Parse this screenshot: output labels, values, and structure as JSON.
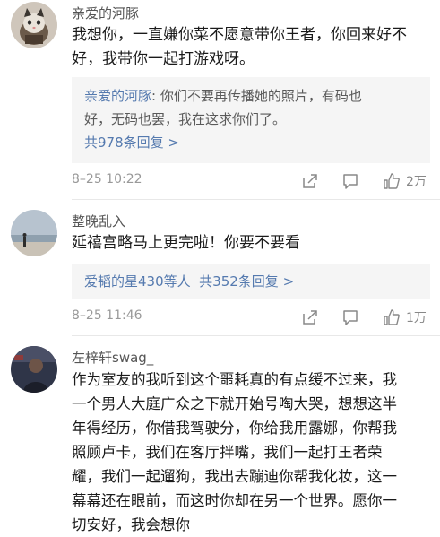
{
  "comments": [
    {
      "username": "亲爱的河豚",
      "lines": [
        "我想你，一直嫌你菜不愿意带你王者，你回来好不",
        "好，我带你一起打游戏呀。"
      ],
      "reply": {
        "author": "亲爱的河豚",
        "colon": ":",
        "text_line1": " 你们不要再传播她的照片，有码也",
        "text_line2": "好，无码也罢，我在这求你们了。",
        "link": "共978条回复 >"
      },
      "time": "8–25 10:22",
      "likes": "2万"
    },
    {
      "username": "整晚乱入",
      "lines": [
        "延禧宫略马上更完啦！你要不要看"
      ],
      "reply": {
        "link": "爱韬的星430等人  共352条回复 >"
      },
      "time": "8–25 11:46",
      "likes": "1万"
    },
    {
      "username": "左梓轩swag_",
      "lines": [
        "作为室友的我听到这个噩耗真的有点缓不过来，我",
        "一个男人大庭广众之下就开始号啕大哭，想想这半",
        "年得经历，你借我驾驶分，你给我用露娜，你帮我",
        "照顾卢卡，我们在客厅拌嘴，我们一起打王者荣",
        "耀，我们一起遛狗，我出去蹦迪你帮我化妆，这一",
        "幕幕还在眼前，而这时你却在另一个世界。愿你一",
        "切安好，我会想你"
      ]
    }
  ],
  "colors": {
    "link": "#557aaf",
    "meta": "#999999",
    "reply_bg": "#f5f5f5"
  },
  "icons": [
    "share-icon",
    "comment-icon",
    "like-icon"
  ]
}
